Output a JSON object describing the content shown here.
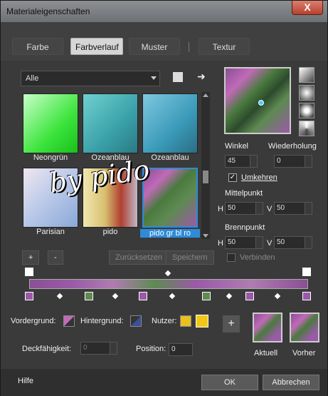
{
  "window": {
    "title": "Materialeigenschaften",
    "close_label": "X"
  },
  "tabs": [
    "Farbe",
    "Farbverlauf",
    "Muster",
    "Textur"
  ],
  "category_select": {
    "value": "Alle"
  },
  "gradients": [
    {
      "name": "Neongrün"
    },
    {
      "name": "Ozeanblau"
    },
    {
      "name": "Ozeanblau"
    },
    {
      "name": "Parisian"
    },
    {
      "name": "pido"
    },
    {
      "name": "pido gr bl ro"
    }
  ],
  "watermark": "by pido",
  "settings": {
    "angle_label": "Winkel",
    "angle_value": "45",
    "repeat_label": "Wiederholung",
    "repeat_value": "0",
    "invert_label": "Umkehren",
    "invert_checked": true,
    "center_label": "Mittelpunkt",
    "center_h_label": "H",
    "center_h": "50",
    "center_v_label": "V",
    "center_v": "50",
    "focus_label": "Brennpunkt",
    "focus_h_label": "H",
    "focus_h": "50",
    "focus_v_label": "V",
    "focus_v": "50",
    "link_label": "Verbinden"
  },
  "list_actions": {
    "add": "+",
    "remove": "-",
    "reset": "Zurücksetzen",
    "save": "Speichern"
  },
  "materials": {
    "foreground_label": "Vordergrund:",
    "background_label": "Hintergrund:",
    "user_label": "Nutzer:",
    "opacity_label": "Deckfähigkeit:",
    "opacity_value": "0",
    "position_label": "Position:",
    "position_value": "0",
    "current_label": "Aktuell",
    "previous_label": "Vorher",
    "add": "+"
  },
  "footer": {
    "help": "Hilfe",
    "ok": "OK",
    "cancel": "Abbrechen"
  }
}
